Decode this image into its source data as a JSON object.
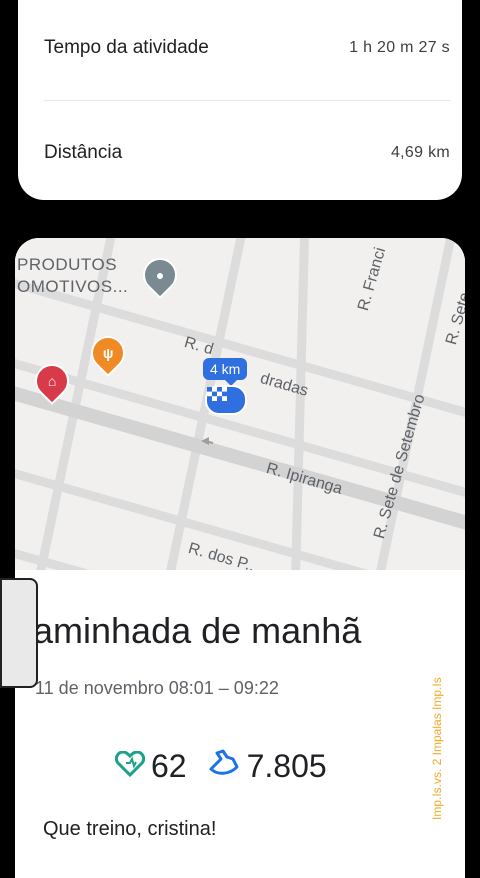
{
  "stats": {
    "activity_time_label": "Tempo da atividade",
    "activity_time_value": "1 h 20 m 27 s",
    "distance_label": "Distância",
    "distance_value": "4,69 km"
  },
  "map": {
    "poi_text_line1": "PRODUTOS",
    "poi_text_line2": "OMOTIVOS...",
    "streets": {
      "street_top": "R. d",
      "street_top_end": "dradas",
      "ipiranga": "R. Ipiranga",
      "sete_de_setembro": "R. Sete de Setembro",
      "francisco": "R. Franci",
      "sete_top": "R. Sete",
      "dos": "R. dos P..."
    },
    "km_marker": "4 km",
    "icons": [
      "place-icon",
      "restaurant-icon",
      "store-icon",
      "finish-flag-icon"
    ]
  },
  "activity": {
    "title": "aminhada de manhã",
    "time_range": "11 de novembro 08:01 – 09:22",
    "heart_points": "62",
    "steps": "7.805",
    "message": "Que treino, cristina!"
  },
  "colors": {
    "route_blue": "#2f6fe0",
    "heart_green": "#1aa38a",
    "steps_blue": "#1a73e8",
    "restaurant_orange": "#f08a24",
    "store_red": "#d93a4a"
  },
  "side_artifact_text": "Imp.Is.vs. 2 Impalas Imp.Is"
}
